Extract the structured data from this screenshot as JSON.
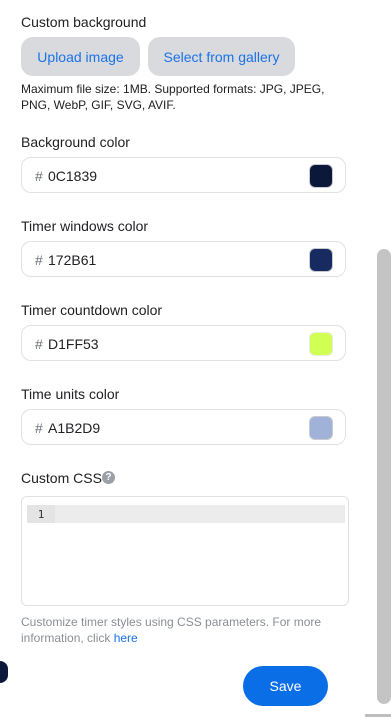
{
  "custom_background": {
    "label": "Custom background",
    "upload_label": "Upload image",
    "gallery_label": "Select from gallery",
    "hint": "Maximum file size: 1MB. Supported formats: JPG, JPEG, PNG, WebP, GIF, SVG, AVIF."
  },
  "colors": {
    "hash_symbol": "#",
    "background": {
      "label": "Background color",
      "value": "0C1839",
      "swatch": "#0C1839"
    },
    "timer_windows": {
      "label": "Timer windows color",
      "value": "172B61",
      "swatch": "#172B61"
    },
    "timer_countdown": {
      "label": "Timer countdown color",
      "value": "D1FF53",
      "swatch": "#D1FF53"
    },
    "time_units": {
      "label": "Time units color",
      "value": "A1B2D9",
      "swatch": "#A1B2D9"
    }
  },
  "custom_css": {
    "label": "Custom CSS",
    "help_glyph": "?",
    "line_number": "1",
    "help_text": "Customize timer styles using CSS parameters. For more information, click ",
    "link_text": "here"
  },
  "save_label": "Save",
  "icons": [
    "help-icon"
  ]
}
